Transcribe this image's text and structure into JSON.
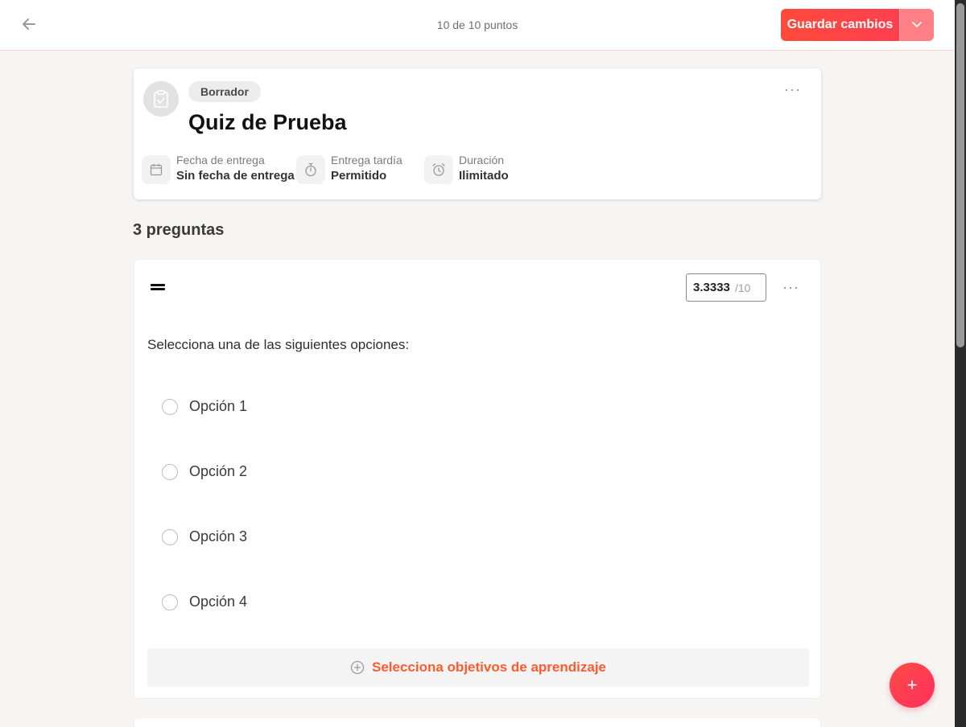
{
  "topbar": {
    "back_icon": "arrow-left-icon",
    "points_text": "10 de 10 puntos",
    "save_label": "Guardar cambios",
    "save_dropdown_icon": "chevron-down-icon"
  },
  "quiz": {
    "icon": "clipboard-check-icon",
    "status": "Borrador",
    "title": "Quiz de Prueba",
    "meta": [
      {
        "icon": "calendar-icon",
        "label": "Fecha de entrega",
        "value": "Sin fecha de entrega"
      },
      {
        "icon": "stopwatch-icon",
        "label": "Entrega tardía",
        "value": "Permitido"
      },
      {
        "icon": "alarm-clock-icon",
        "label": "Duración",
        "value": "Ilimitado"
      }
    ]
  },
  "questions_count": "3 preguntas",
  "question": {
    "score_value": "3.3333",
    "score_max": "/10",
    "text": "Selecciona una de las siguientes opciones:",
    "options": [
      "Opción 1",
      "Opción 2",
      "Opción 3",
      "Opción 4"
    ],
    "objectives_label": "Selecciona objetivos de aprendizaje"
  },
  "fab_label": "+",
  "colors": {
    "accent": "#ff4b3a",
    "accent_light": "#ff7f86",
    "link_orange": "#ff5a2e"
  }
}
